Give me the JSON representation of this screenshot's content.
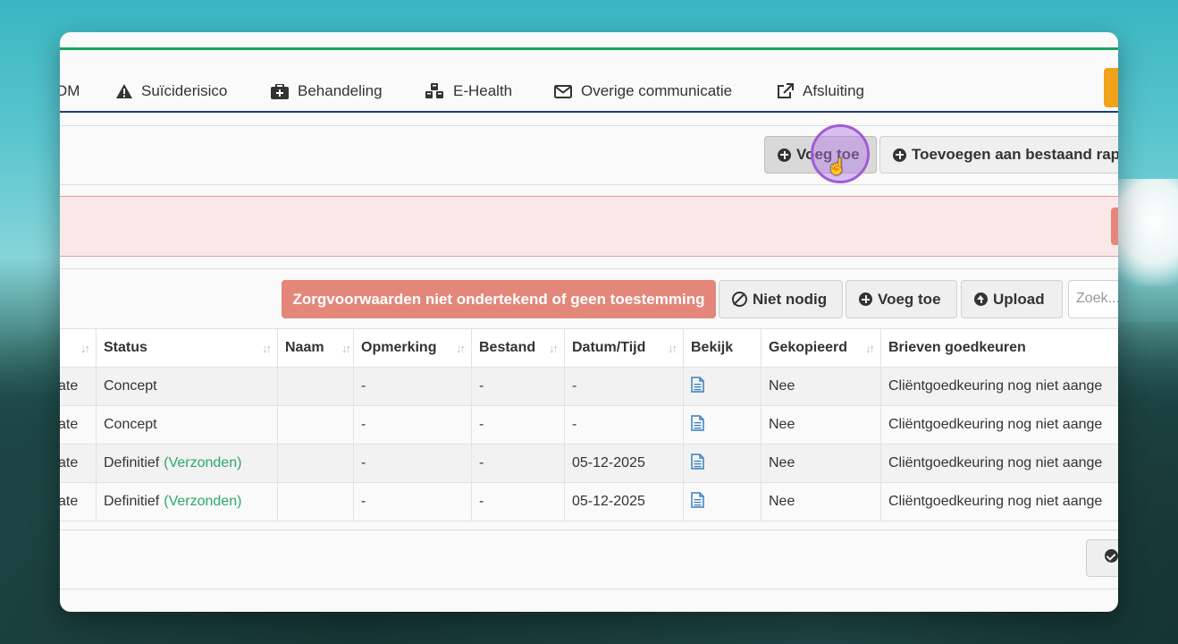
{
  "nav": {
    "tabs": [
      {
        "label": "OM",
        "icon": "none"
      },
      {
        "label": "Suïciderisico",
        "icon": "warning-icon"
      },
      {
        "label": "Behandeling",
        "icon": "medkit-icon"
      },
      {
        "label": "E-Health",
        "icon": "cubes-icon"
      },
      {
        "label": "Overige communicatie",
        "icon": "envelope-icon"
      },
      {
        "label": "Afsluiting",
        "icon": "external-link-icon"
      }
    ]
  },
  "toolbar": {
    "voeg_toe": "Voeg toe",
    "toevoegen_bestaand": "Toevoegen aan bestaand rap"
  },
  "letters": {
    "warning_button": "Zorgvoorwaarden niet ondertekend of geen toestemming",
    "niet_nodig": "Niet nodig",
    "voeg_toe": "Voeg toe",
    "upload": "Upload",
    "search_placeholder": "Zoek..."
  },
  "table": {
    "headers": [
      "",
      "Status",
      "Naam",
      "Opmerking",
      "Bestand",
      "Datum/Tijd",
      "Bekijk",
      "Gekopieerd",
      "Brieven goedkeuren"
    ],
    "rows": [
      {
        "col0": "ate",
        "status": "Concept",
        "status_extra": "",
        "naam": "",
        "opmerking": "-",
        "bestand": "-",
        "datum": "-",
        "gekopieerd": "Nee",
        "brieven": "Cliëntgoedkeuring nog niet aange"
      },
      {
        "col0": "ate",
        "status": "Concept",
        "status_extra": "",
        "naam": "",
        "opmerking": "-",
        "bestand": "-",
        "datum": "-",
        "gekopieerd": "Nee",
        "brieven": "Cliëntgoedkeuring nog niet aange"
      },
      {
        "col0": "ate",
        "status": "Definitief",
        "status_extra": "(Verzonden)",
        "naam": "",
        "opmerking": "-",
        "bestand": "-",
        "datum": "05-12-2025",
        "gekopieerd": "Nee",
        "brieven": "Cliëntgoedkeuring nog niet aange"
      },
      {
        "col0": "ate",
        "status": "Definitief",
        "status_extra": "(Verzonden)",
        "naam": "",
        "opmerking": "-",
        "bestand": "-",
        "datum": "05-12-2025",
        "gekopieerd": "Nee",
        "brieven": "Cliëntgoedkeuring nog niet aange"
      }
    ]
  },
  "colors": {
    "accent_green": "#1aa359",
    "nav_underline": "#1d3f74",
    "warning": "#e4877b",
    "status_sent": "#2aa86a",
    "orange": "#f0a21a"
  }
}
